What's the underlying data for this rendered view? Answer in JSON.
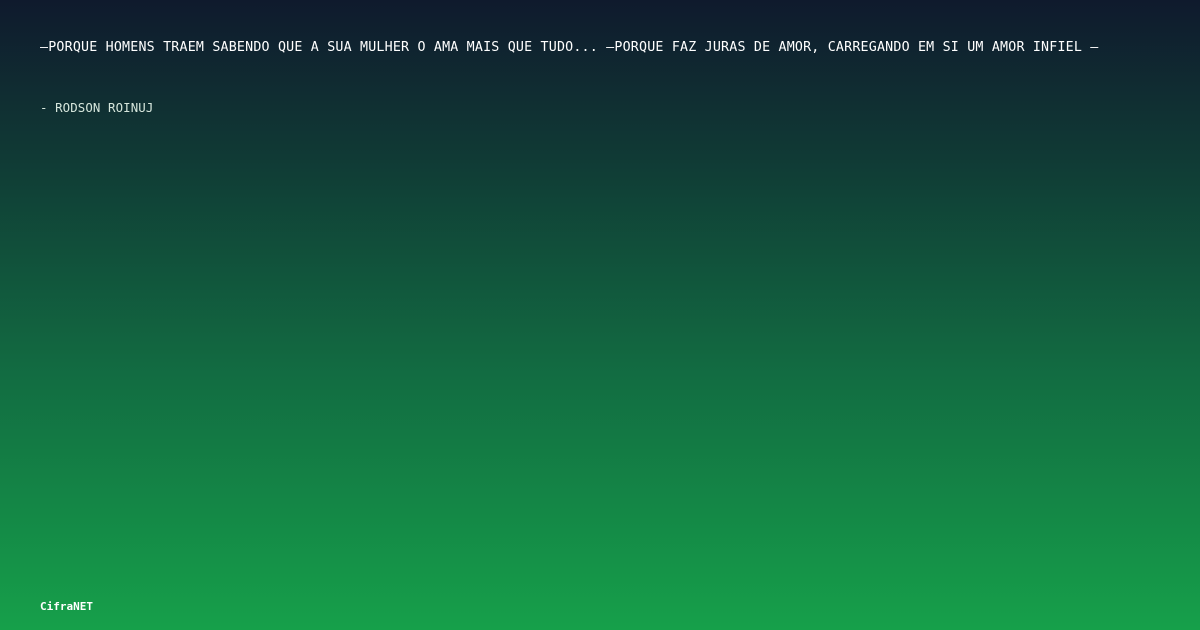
{
  "quote": {
    "text": "—PORQUE HOMENS TRAEM SABENDO QUE A SUA MULHER O AMA MAIS QUE TUDO... —PORQUE FAZ JURAS DE AMOR, CARREGANDO EM SI UM AMOR INFIEL —"
  },
  "author": {
    "line": "- RODSON ROINUJ"
  },
  "brand": {
    "name": "CifraNET"
  },
  "colors": {
    "gradient_top": "#0f1a2d",
    "gradient_bottom": "#16a04a",
    "text": "#ffffff"
  }
}
